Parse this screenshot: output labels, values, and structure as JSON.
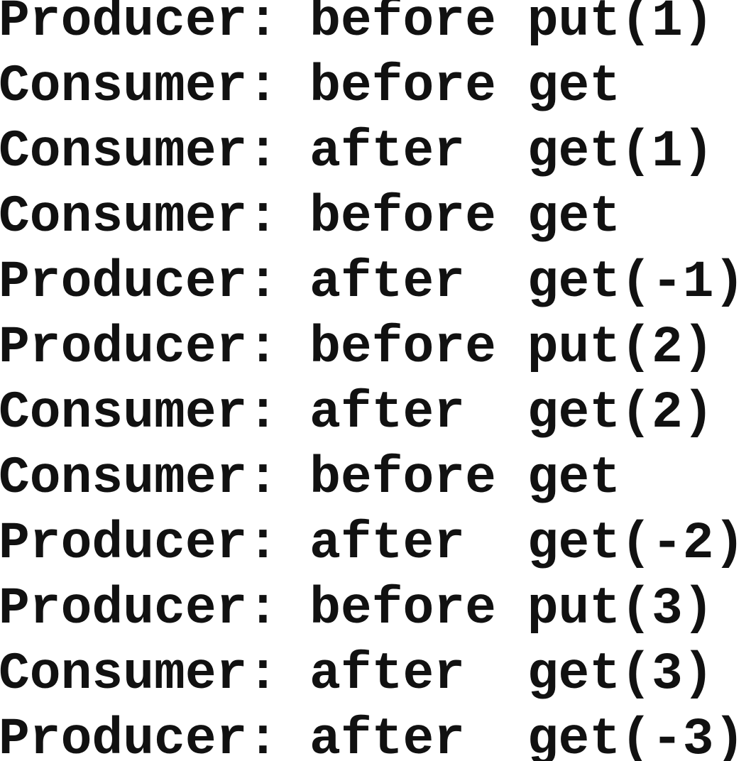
{
  "output": {
    "lines": [
      "Producer: before put(1)",
      "Consumer: before get",
      "Consumer: after  get(1)",
      "Consumer: before get",
      "Producer: after  get(-1)",
      "Producer: before put(2)",
      "Consumer: after  get(2)",
      "Consumer: before get",
      "Producer: after  get(-2)",
      "Producer: before put(3)",
      "Consumer: after  get(3)",
      "Producer: after  get(-3)"
    ]
  }
}
